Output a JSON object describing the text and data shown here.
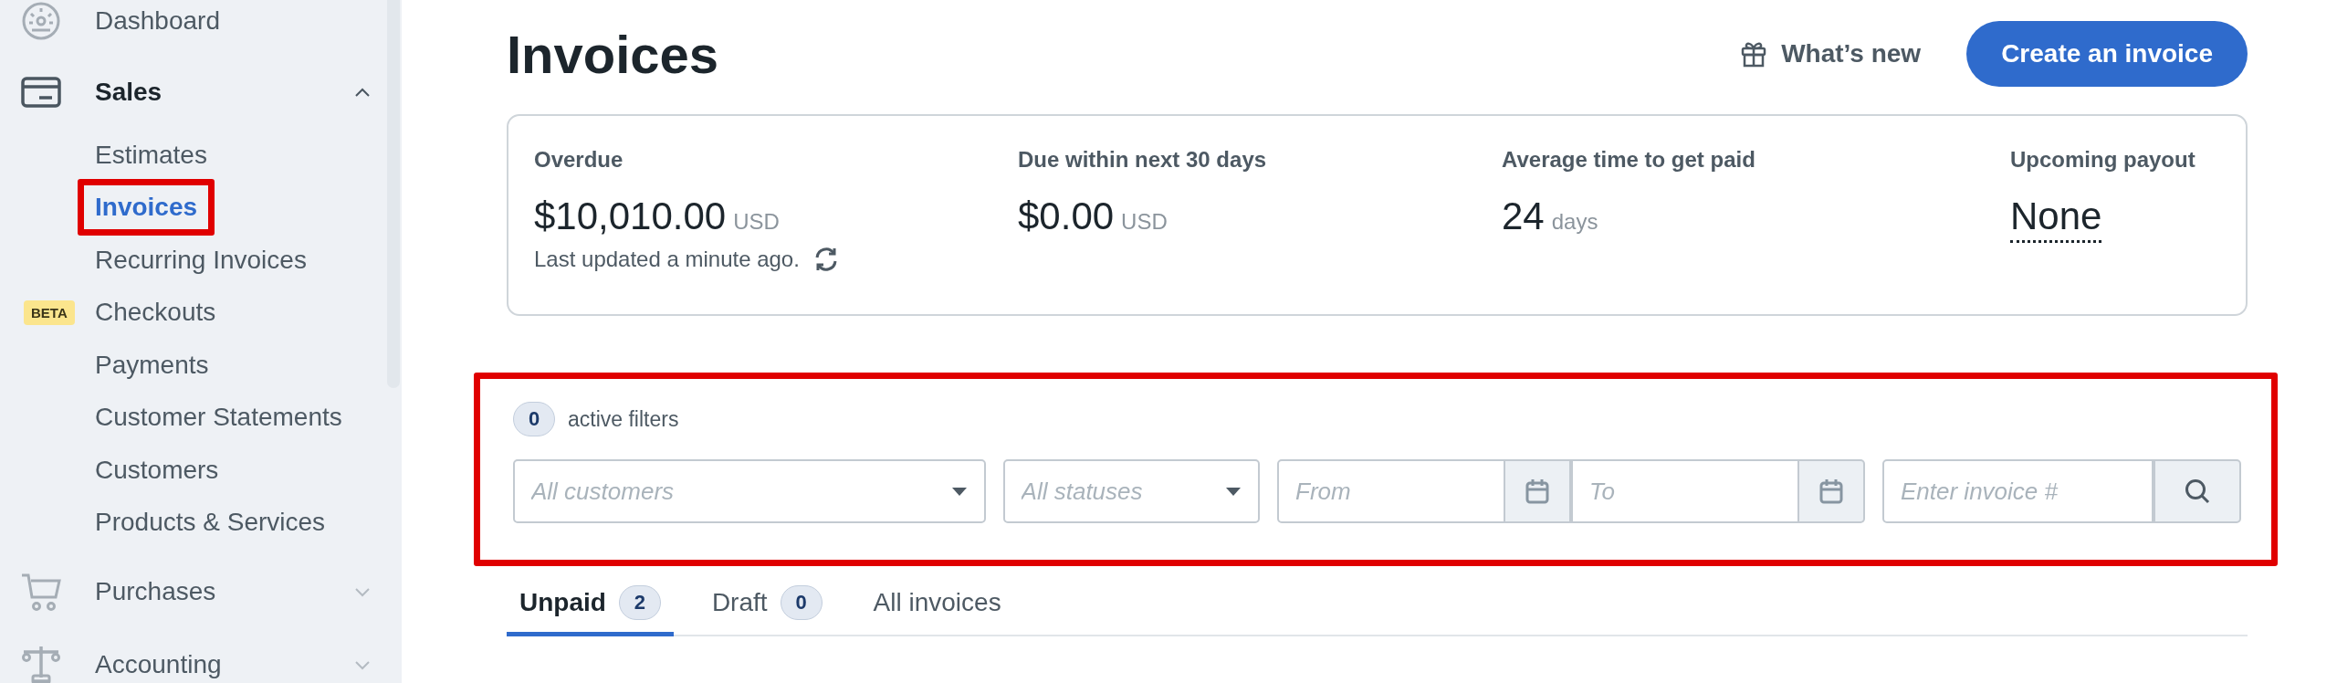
{
  "sidebar": {
    "items": [
      {
        "label": "Dashboard"
      },
      {
        "label": "Sales",
        "expanded": true,
        "children": [
          {
            "label": "Estimates",
            "selected": false
          },
          {
            "label": "Invoices",
            "selected": true,
            "annotated": true
          },
          {
            "label": "Recurring Invoices",
            "selected": false
          },
          {
            "label": "Checkouts",
            "selected": false,
            "badge": "BETA"
          },
          {
            "label": "Payments",
            "selected": false
          },
          {
            "label": "Customer Statements",
            "selected": false
          },
          {
            "label": "Customers",
            "selected": false
          },
          {
            "label": "Products & Services",
            "selected": false
          }
        ]
      },
      {
        "label": "Purchases",
        "expanded": false
      },
      {
        "label": "Accounting",
        "expanded": false
      }
    ]
  },
  "header": {
    "title": "Invoices",
    "whats_new": "What’s new",
    "create_button": "Create an invoice"
  },
  "summary": {
    "items": [
      {
        "kind": "amount",
        "label": "Overdue",
        "value": "$10,010.00",
        "unit": "USD",
        "note": "Last updated a minute ago."
      },
      {
        "kind": "amount",
        "label": "Due within next 30 days",
        "value": "$0.00",
        "unit": "USD"
      },
      {
        "kind": "amount",
        "label": "Average time to get paid",
        "value": "24",
        "unit": "days"
      },
      {
        "kind": "hint",
        "label": "Upcoming payout",
        "value": "None"
      }
    ]
  },
  "filters": {
    "annotated": true,
    "active_count": "0",
    "active_label": "active filters",
    "customer": {
      "placeholder": "All customers"
    },
    "status": {
      "placeholder": "All statuses"
    },
    "from": {
      "placeholder": "From"
    },
    "to": {
      "placeholder": "To"
    },
    "invoice": {
      "placeholder": "Enter invoice #"
    }
  },
  "tabs": [
    {
      "label": "Unpaid",
      "count": "2",
      "selected": true
    },
    {
      "label": "Draft",
      "count": "0",
      "selected": false
    },
    {
      "label": "All invoices",
      "selected": false
    }
  ]
}
